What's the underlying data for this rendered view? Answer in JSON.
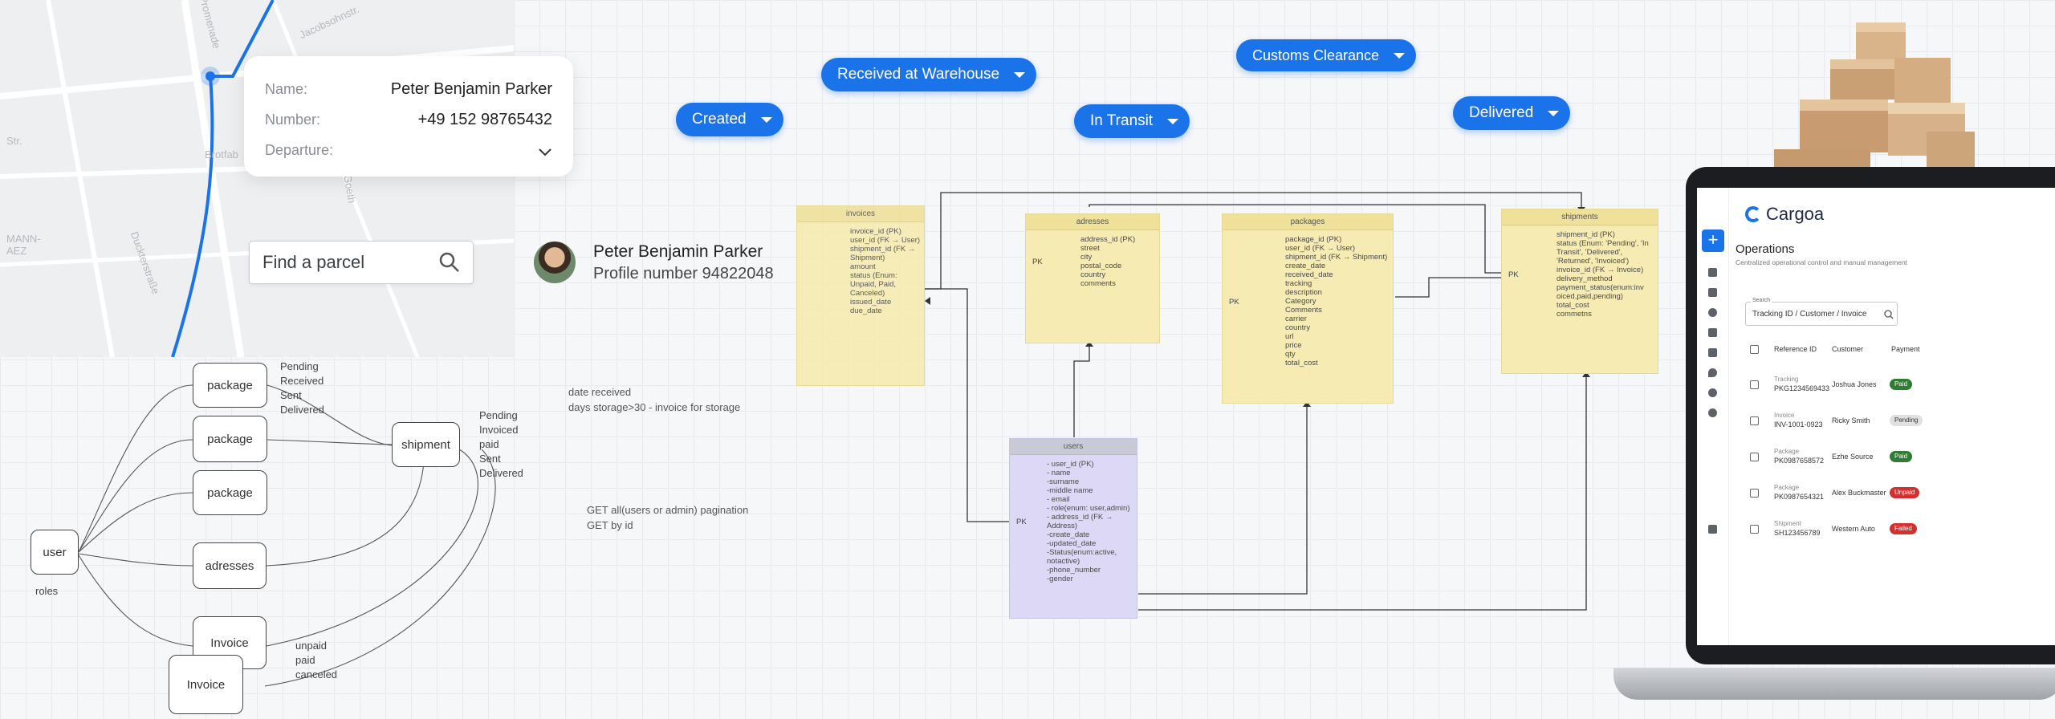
{
  "map": {
    "streets": [
      "Promenade",
      "Jacobsohnstr.",
      "Str.",
      "Brotfab",
      "Goeth",
      "MANN-\nAEZ",
      "Duckterstraße"
    ]
  },
  "profile_card": {
    "name_label": "Name:",
    "name_value": "Peter Benjamin Parker",
    "number_label": "Number:",
    "number_value": "+49 152 98765432",
    "departure_label": "Departure:"
  },
  "search": {
    "placeholder": "Find a parcel"
  },
  "profile": {
    "name": "Peter Benjamin Parker",
    "number": "Profile number 94822048"
  },
  "statuses": {
    "created": "Created",
    "received": "Received at Warehouse",
    "transit": "In Transit",
    "customs": "Customs Clearance",
    "delivered": "Delivered"
  },
  "er": {
    "invoices": {
      "title": "invoices",
      "fields": [
        "invoice_id (PK)",
        "user_id (FK → User)",
        "shipment_id (FK →",
        "Shipment)",
        "amount",
        "status (Enum:",
        "Unpaid, Paid,",
        "Canceled)",
        "issued_date",
        "due_date"
      ]
    },
    "adresses": {
      "title": "adresses",
      "pk": "PK",
      "fields": [
        "address_id (PK)",
        "street",
        "city",
        "postal_code",
        "country",
        "comments"
      ]
    },
    "packages": {
      "title": "packages",
      "pk": "PK",
      "fields": [
        "package_id (PK)",
        "user_id (FK → User)",
        "shipment_id (FK → Shipment)",
        "create_date",
        "received_date",
        "tracking",
        "description",
        "Category",
        "Comments",
        "carrier",
        "country",
        "url",
        "price",
        "qty",
        "total_cost"
      ]
    },
    "shipments": {
      "title": "shipments",
      "pk": "PK",
      "fields": [
        "shipment_id (PK)",
        "status (Enum: 'Pending', 'In",
        "Transit', 'Delivered',",
        "'Returned', 'Invoiced')",
        "invoice_id (FK → Invoice)",
        "delivery_method",
        "payment_status(enum:inv",
        "oiced,paid,pending)",
        "total_cost",
        "commetns"
      ]
    },
    "users": {
      "title": "users",
      "pk": "PK",
      "fields": [
        "- user_id (PK)",
        "- name",
        "-surname",
        "-middle name",
        "- email",
        "- role(enum: user,admin)",
        "- address_id (FK →",
        "Address)",
        "-create_date",
        "-updated_date",
        "-Status(enum:active,",
        "notactive)",
        "-phone_number",
        "-gender"
      ]
    }
  },
  "notes": {
    "storage": [
      "date received",
      "days storage>30 - invoice for storage"
    ],
    "api": [
      "GET all(users or admin) pagination",
      "GET by id"
    ]
  },
  "sketch": {
    "package": "package",
    "shipment": "shipment",
    "user": "user",
    "adresses": "adresses",
    "invoice": "Invoice",
    "roles": "roles",
    "pkg_statuses": [
      "Pending",
      "Received",
      "Sent",
      "Delivered"
    ],
    "ship_statuses": [
      "Pending",
      "Invoiced",
      "paid",
      "Sent",
      "Delivered"
    ],
    "inv_statuses": [
      "unpaid",
      "paid",
      "canceled"
    ]
  },
  "app": {
    "brand": "Cargoa",
    "title": "Operations",
    "subtitle": "Centralized operational control and manual management",
    "search_label": "Search",
    "search_value": "Tracking ID / Customer / Invoice",
    "headers": {
      "ref": "Reference ID",
      "customer": "Customer",
      "payment": "Payment"
    },
    "rows": [
      {
        "type": "Tracking",
        "id": "PKG1234569433",
        "customer": "Joshua Jones",
        "status": "Paid",
        "color": "#2e7d32"
      },
      {
        "type": "Invoice",
        "id": "INV-1001-0923",
        "customer": "Ricky Smith",
        "status": "Pending",
        "color": "#e0e0e0"
      },
      {
        "type": "Package",
        "id": "PK0987658572",
        "customer": "Ezhe Source",
        "status": "Paid",
        "color": "#2e7d32"
      },
      {
        "type": "Package",
        "id": "PK0987654321",
        "customer": "Alex Buckmaster",
        "status": "Unpaid",
        "color": "#d32f2f"
      },
      {
        "type": "Shipment",
        "id": "SH123456789",
        "customer": "Western Auto",
        "status": "Failed",
        "color": "#d32f2f"
      }
    ]
  }
}
